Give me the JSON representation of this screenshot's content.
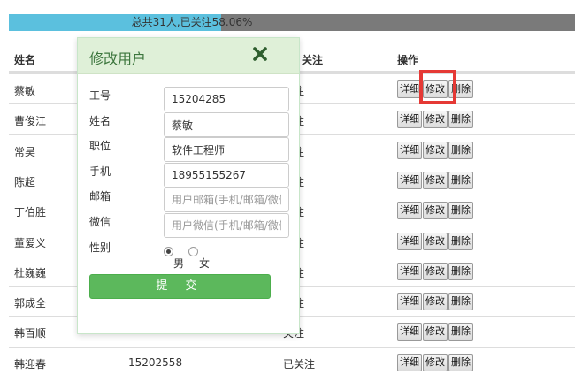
{
  "progress": {
    "label": "总共31人,已关注58.06%",
    "percent": 58.06,
    "fill_color": "#5bc0de",
    "track_color": "#7a7a7a"
  },
  "table": {
    "headers": {
      "name": "姓名",
      "status": "关注",
      "actions": "操作"
    },
    "action_labels": {
      "detail": "详细",
      "edit": "修改",
      "delete": "删除"
    },
    "rows": [
      {
        "name": "蔡敏",
        "id": "",
        "status": "关注"
      },
      {
        "name": "曹俊江",
        "id": "",
        "status": "关注"
      },
      {
        "name": "常昊",
        "id": "",
        "status": "关注"
      },
      {
        "name": "陈超",
        "id": "",
        "status": "关注"
      },
      {
        "name": "丁伯胜",
        "id": "",
        "status": "关注"
      },
      {
        "name": "董爱义",
        "id": "",
        "status": "关注"
      },
      {
        "name": "杜巍巍",
        "id": "",
        "status": "关注"
      },
      {
        "name": "郭成全",
        "id": "",
        "status": "关注"
      },
      {
        "name": "韩百顺",
        "id": "",
        "status": "关注"
      },
      {
        "name": "韩迎春",
        "id": "15202558",
        "status": "已关注"
      }
    ]
  },
  "modal": {
    "title": "修改用户",
    "close_icon": "close-x-icon",
    "header_color": "#dff0d8",
    "fields": {
      "job_no": {
        "label": "工号",
        "value": "15204285"
      },
      "name": {
        "label": "姓名",
        "value": "蔡敏"
      },
      "position": {
        "label": "职位",
        "value": "软件工程师"
      },
      "phone": {
        "label": "手机",
        "value": "18955155267"
      },
      "email": {
        "label": "邮箱",
        "placeholder": "用户邮箱(手机/邮箱/微信)"
      },
      "wechat": {
        "label": "微信",
        "placeholder": "用户微信(手机/邮箱/微信)"
      }
    },
    "gender": {
      "label": "性别",
      "male": "男",
      "female": "女",
      "selected": "male"
    },
    "submit_label": "提 交",
    "submit_color": "#5cb85c"
  },
  "highlight_color": "#e53935"
}
